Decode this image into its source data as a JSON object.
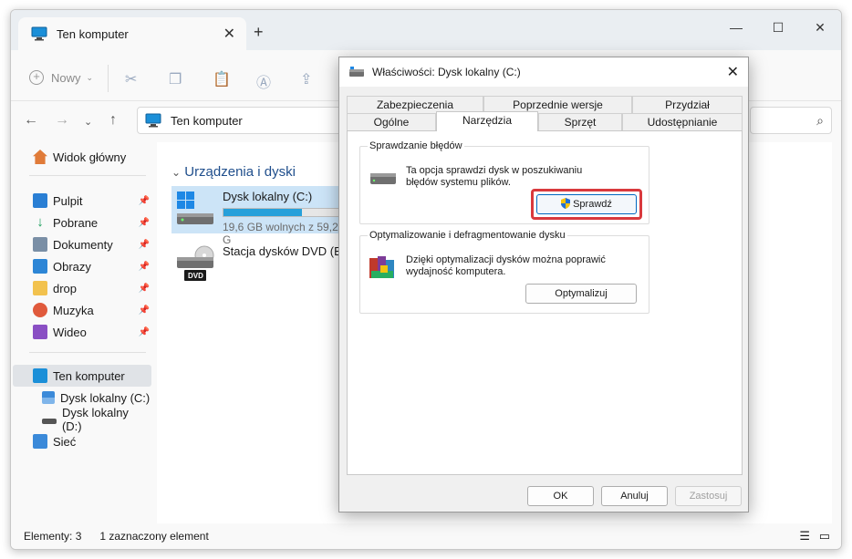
{
  "explorer": {
    "tab_title": "Ten komputer",
    "toolbar": {
      "new_label": "Nowy"
    },
    "address": "Ten komputer",
    "sidebar": {
      "home": "Widok główny",
      "quick": [
        {
          "label": "Pulpit"
        },
        {
          "label": "Pobrane"
        },
        {
          "label": "Dokumenty"
        },
        {
          "label": "Obrazy"
        },
        {
          "label": "drop"
        },
        {
          "label": "Muzyka"
        },
        {
          "label": "Wideo"
        }
      ],
      "this_pc": "Ten komputer",
      "drives": [
        {
          "label": "Dysk lokalny (C:)"
        },
        {
          "label": "Dysk lokalny (D:)"
        }
      ],
      "network": "Sieć"
    },
    "content": {
      "group_header": "Urządzenia i dyski",
      "drive_c": {
        "name": "Dysk lokalny (C:)",
        "free": "19,6 GB wolnych z 59,2 G",
        "used_fraction": 0.67
      },
      "drive_dvd": {
        "name": "Stacja dysków DVD (E:)",
        "badge": "DVD"
      }
    },
    "status": {
      "items": "Elementy: 3",
      "selected": "1 zaznaczony element"
    }
  },
  "dialog": {
    "title": "Właściwości: Dysk lokalny (C:)",
    "tabs_row1": [
      "Zabezpieczenia",
      "Poprzednie wersje",
      "Przydział"
    ],
    "tabs_row2": [
      "Ogólne",
      "Narzędzia",
      "Sprzęt",
      "Udostępnianie"
    ],
    "active_tab": "Narzędzia",
    "error_check": {
      "legend": "Sprawdzanie błędów",
      "line1": "Ta opcja sprawdzi dysk w poszukiwaniu",
      "line2": "błędów systemu plików.",
      "button": "Sprawdź"
    },
    "optimize": {
      "legend": "Optymalizowanie i defragmentowanie dysku",
      "line1": "Dzięki optymalizacji dysków można poprawić",
      "line2": "wydajność komputera.",
      "button": "Optymalizuj"
    },
    "buttons": {
      "ok": "OK",
      "cancel": "Anuluj",
      "apply": "Zastosuj"
    }
  },
  "colors": {
    "accent": "#0067c0",
    "highlight": "#d9393d",
    "progress": "#26a0da"
  }
}
